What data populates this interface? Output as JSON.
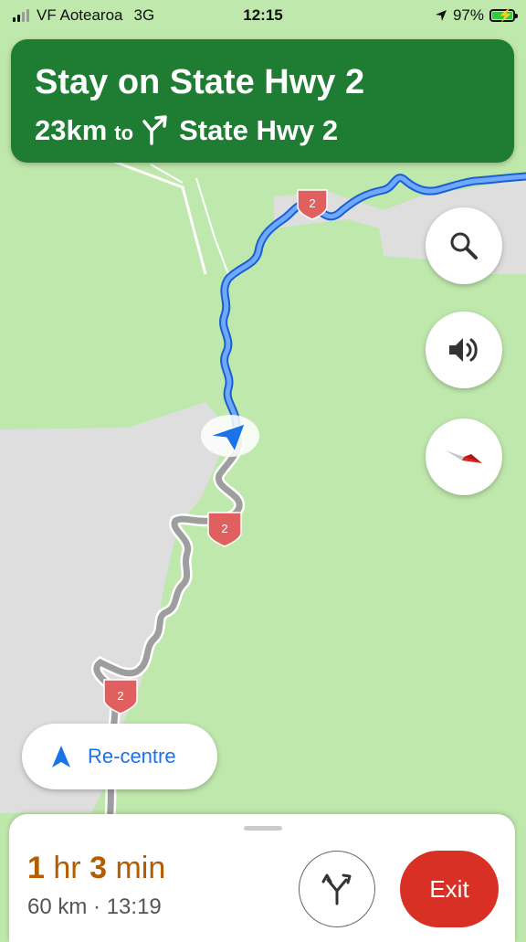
{
  "status_bar": {
    "carrier": "VF Aotearoa",
    "network": "3G",
    "time": "12:15",
    "battery": "97%",
    "signal_bars_on": 2,
    "signal_bars_total": 4
  },
  "banner": {
    "instruction": "Stay on State Hwy 2",
    "distance": "23km",
    "to_word": "to",
    "next_road": "State Hwy 2",
    "turn_icon": "slight-right-icon",
    "color": "#1e7d33"
  },
  "map": {
    "route_shield_label": "2",
    "route_color": "#4285f4",
    "travelled_color": "#9e9e9e",
    "land_color": "#bfe8ac",
    "urban_color": "#dedede"
  },
  "controls": {
    "search_icon": "search-icon",
    "sound_icon": "volume-icon",
    "compass_icon": "compass-icon",
    "recentre_label": "Re-centre"
  },
  "trip": {
    "hours": "1",
    "hours_unit": "hr",
    "minutes": "3",
    "minutes_unit": "min",
    "distance": "60 km",
    "separator": "·",
    "arrival": "13:19",
    "exit_label": "Exit",
    "eta_color": "#b35c00",
    "exit_color": "#d93025"
  }
}
